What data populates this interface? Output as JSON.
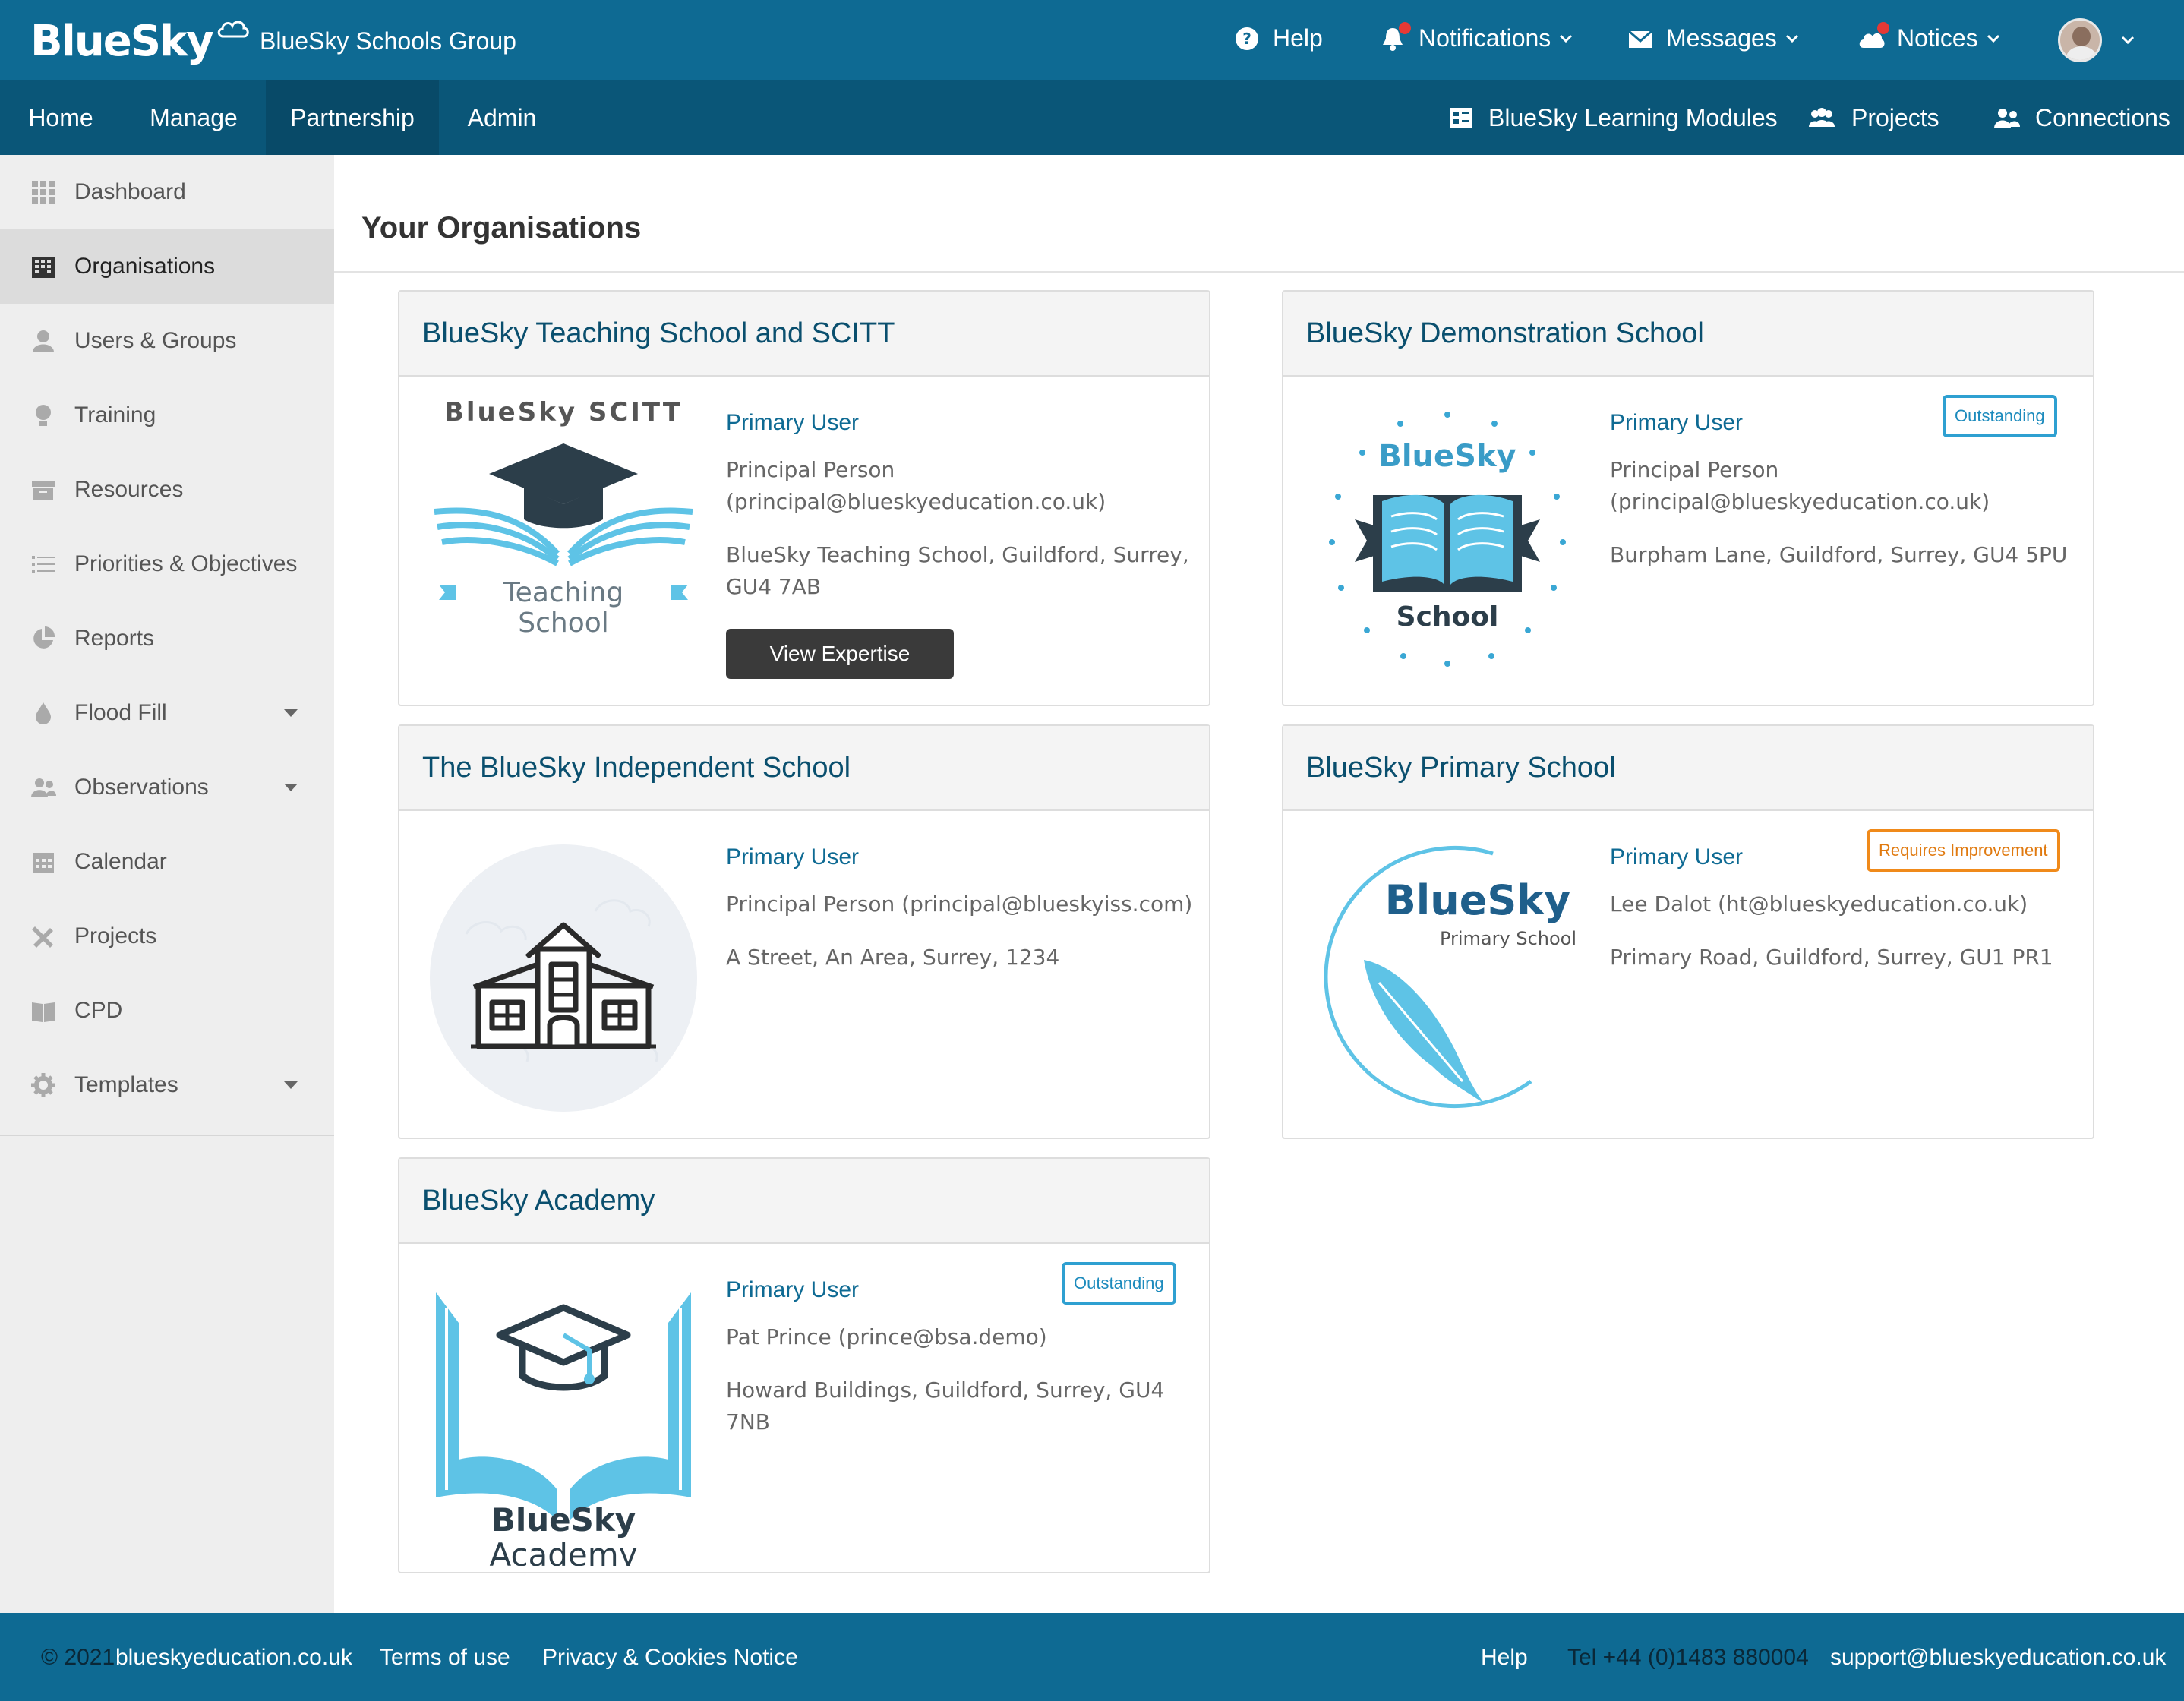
{
  "header": {
    "logo_text": "BlueSky",
    "org_name": "BlueSky Schools Group",
    "help": "Help",
    "notifications": "Notifications",
    "messages": "Messages",
    "notices": "Notices",
    "brand_color": "#0e6a93"
  },
  "nav": {
    "items": [
      "Home",
      "Manage",
      "Partnership",
      "Admin"
    ],
    "active": "Partnership",
    "right": [
      "BlueSky Learning Modules",
      "Projects",
      "Connections"
    ]
  },
  "sidebar": {
    "items": [
      {
        "label": "Dashboard",
        "icon": "grid-icon"
      },
      {
        "label": "Organisations",
        "icon": "building-icon",
        "active": true
      },
      {
        "label": "Users & Groups",
        "icon": "user-icon"
      },
      {
        "label": "Training",
        "icon": "lightbulb-icon"
      },
      {
        "label": "Resources",
        "icon": "archive-icon"
      },
      {
        "label": "Priorities & Objectives",
        "icon": "list-icon"
      },
      {
        "label": "Reports",
        "icon": "pie-chart-icon"
      },
      {
        "label": "Flood Fill",
        "icon": "drop-icon",
        "expandable": true
      },
      {
        "label": "Observations",
        "icon": "users-icon",
        "expandable": true
      },
      {
        "label": "Calendar",
        "icon": "calendar-icon"
      },
      {
        "label": "Projects",
        "icon": "tools-icon"
      },
      {
        "label": "CPD",
        "icon": "book-icon"
      },
      {
        "label": "Templates",
        "icon": "gear-icon",
        "expandable": true
      }
    ]
  },
  "main": {
    "title": "Your Organisations",
    "cards": [
      {
        "name": "BlueSky Teaching School and SCITT",
        "primary_user_label": "Primary User",
        "user_line1": "Principal Person",
        "user_line2": "(principal@blueskyeducation.co.uk)",
        "address_line1": "BlueSky Teaching School, Guildford, Surrey,",
        "address_line2": "GU4 7AB",
        "button": "View Expertise",
        "logo_top": "BlueSky SCITT",
        "logo_line1": "Teaching",
        "logo_line2": "School"
      },
      {
        "name": "BlueSky Demonstration School",
        "primary_user_label": "Primary User",
        "user_line1": "Principal Person",
        "user_line2": "(principal@blueskyeducation.co.uk)",
        "address_line1": "Burpham Lane, Guildford, Surrey, GU4 5PU",
        "badge": "Outstanding",
        "logo_top": "BlueSky",
        "logo_bottom": "School"
      },
      {
        "name": "The BlueSky Independent School",
        "primary_user_label": "Primary User",
        "user_line1": "Principal Person (principal@blueskyiss.com)",
        "address_line1": "A Street, An Area, Surrey, 1234"
      },
      {
        "name": "BlueSky Primary School",
        "primary_user_label": "Primary User",
        "user_line1": "Lee Dalot (ht@blueskyeducation.co.uk)",
        "address_line1": "Primary Road, Guildford, Surrey, GU1 PR1",
        "badge": "Requires Improvement",
        "logo_top": "BlueSky",
        "logo_sub": "Primary School"
      },
      {
        "name": "BlueSky Academy",
        "primary_user_label": "Primary User",
        "user_line1": "Pat Prince (prince@bsa.demo)",
        "address_line1": "Howard Buildings, Guildford, Surrey, GU4 7NB",
        "badge": "Outstanding",
        "logo_line1": "BlueSky",
        "logo_line2": "Academy"
      }
    ]
  },
  "footer": {
    "copyright": "© 2021",
    "site": "blueskyeducation.co.uk",
    "terms": "Terms of use",
    "privacy": "Privacy & Cookies Notice",
    "help": "Help",
    "tel": "Tel +44 (0)1483 880004",
    "email": "support@blueskyeducation.co.uk"
  }
}
